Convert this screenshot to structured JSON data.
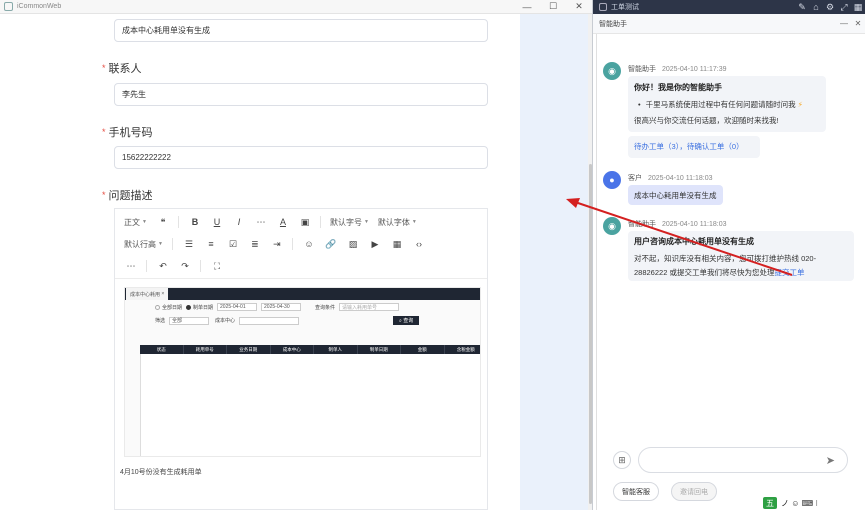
{
  "left_window": {
    "title": "iCommonWeb",
    "controls": {
      "minimize": "—",
      "maximize": "☐",
      "close": "✕"
    },
    "form": {
      "summary_value": "成本中心耗用单没有生成",
      "contact": {
        "label": "联系人",
        "value": "李先生"
      },
      "phone": {
        "label": "手机号码",
        "value": "15622222222"
      },
      "description": {
        "label": "问题描述"
      },
      "required_mark": "*"
    },
    "editor": {
      "toolbar_row1": {
        "paragraph": "正文",
        "font_size": "默认字号",
        "font_family": "默认字体"
      },
      "toolbar_row2": {
        "line_height": "默认行高"
      },
      "content_text": "4月10号份没有生成耗用单",
      "embedded_screenshot": {
        "tab": "成本中心耗用",
        "tab_close": "×",
        "radio_all": "全部日期",
        "radio_date": "制单日期",
        "date_from": "2025-04-01",
        "date_to": "2025-04-30",
        "query_label": "查询条件",
        "query_placeholder": "请输入耗用单号",
        "filter_label": "筛选",
        "filter_value": "全部",
        "cost_center_label": "成本中心",
        "search_button": "查询",
        "columns": [
          "状态",
          "耗用单号",
          "业务日期",
          "成本中心",
          "制单人",
          "制单日期",
          "金额",
          "含税金额"
        ]
      }
    }
  },
  "right_window": {
    "title": "工单测试",
    "subtitle": "智能助手",
    "messages": {
      "bot1": {
        "sender": "智能助手",
        "time": "2025-04-10 11:17:39",
        "greeting": "你好！我是你的智能助手",
        "bullet": "千里马系统使用过程中有任何问题请随时问我",
        "line2": "很高兴与你交流任何话题，欢迎随时来找我!",
        "links": {
          "pending": "待办工单（3）",
          "sep": "，",
          "confirm": "待确认工单（0）"
        }
      },
      "user1": {
        "sender": "客户",
        "time": "2025-04-10 11:18:03",
        "text": "成本中心耗用单没有生成"
      },
      "bot2": {
        "sender": "智能助手",
        "time": "2025-04-10 11:18:03",
        "title": "用户咨询成本中心耗用单没有生成",
        "body_line1": "对不起，知识库没有相关内容，您可拨打维护热线 020-",
        "body_line2_prefix": "28826222 或提交工单我们将尽快为您处理",
        "body_link": "提交工单"
      }
    },
    "buttons": {
      "smart_service": "智能客服",
      "request_callback": "邀请回电"
    },
    "ime": {
      "label": "五",
      "extra": "ノ ☺ ⌨ ⁝"
    }
  }
}
